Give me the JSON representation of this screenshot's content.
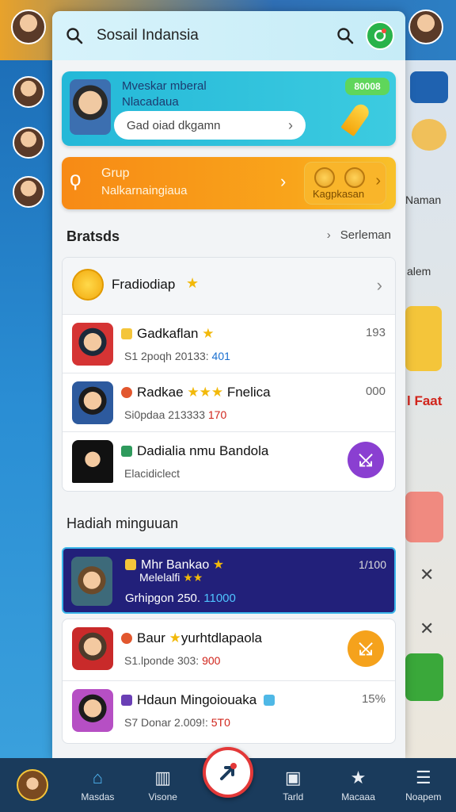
{
  "search": {
    "title": "Sosail Indansia"
  },
  "promo": {
    "line1": "Mveskar mberal",
    "line2": "Nlacadaua",
    "input_placeholder": "Gad oiad dkgamn",
    "badge": "80008"
  },
  "group_card": {
    "title": "Grup",
    "subtitle": "Nalkarnaingiaua",
    "button_label": "Kagpkasan"
  },
  "section1": {
    "title": "Bratsds",
    "see_all": "Serleman"
  },
  "list1": {
    "header": {
      "name": "Fradiodiap"
    },
    "rows": [
      {
        "name": "Gadkaflan",
        "sub_prefix": "S1 2poqh 20133:",
        "sub_highlight": "401",
        "num": "193"
      },
      {
        "name": "Radkae",
        "name_suffix": "Fnelica",
        "sub_prefix": "Si0pdaa 213333",
        "sub_highlight": "170",
        "num": "000"
      },
      {
        "name": "Dadialia nmu Bandola",
        "sub_prefix": "Elacidiclect",
        "sub_highlight": "",
        "num": ""
      }
    ]
  },
  "section2": {
    "title": "Hadiah minguuan"
  },
  "weekly": {
    "highlight": {
      "name": "Mhr Bankao",
      "name2": "Melelalfi",
      "sub_prefix": "Grhipgon 250.",
      "sub_highlight": "11000",
      "num": "1/100"
    },
    "rows": [
      {
        "name": "Baur",
        "name_suffix": "yurhtdlapaola",
        "sub_prefix": "S1.lponde 303:",
        "sub_highlight": "900",
        "num": ""
      },
      {
        "name": "Hdaun Mingoiouaka",
        "sub_prefix": "S7 Donar 2.009!:",
        "sub_highlight": "5T0",
        "num": "15%"
      }
    ]
  },
  "background": {
    "right_label1": "Naman",
    "right_label2": "alem",
    "right_label3": "l Faat"
  },
  "nav": {
    "items": [
      {
        "label": ""
      },
      {
        "label": "Masdas"
      },
      {
        "label": "Visone"
      },
      {
        "label": ""
      },
      {
        "label": "Tarld"
      },
      {
        "label": "Macaaa"
      },
      {
        "label": "Noapem"
      }
    ]
  },
  "colors": {
    "accent_blue": "#24b8d8",
    "accent_orange": "#f78a15",
    "nav_bg": "#1a3b5c",
    "highlight": "#22207a"
  }
}
